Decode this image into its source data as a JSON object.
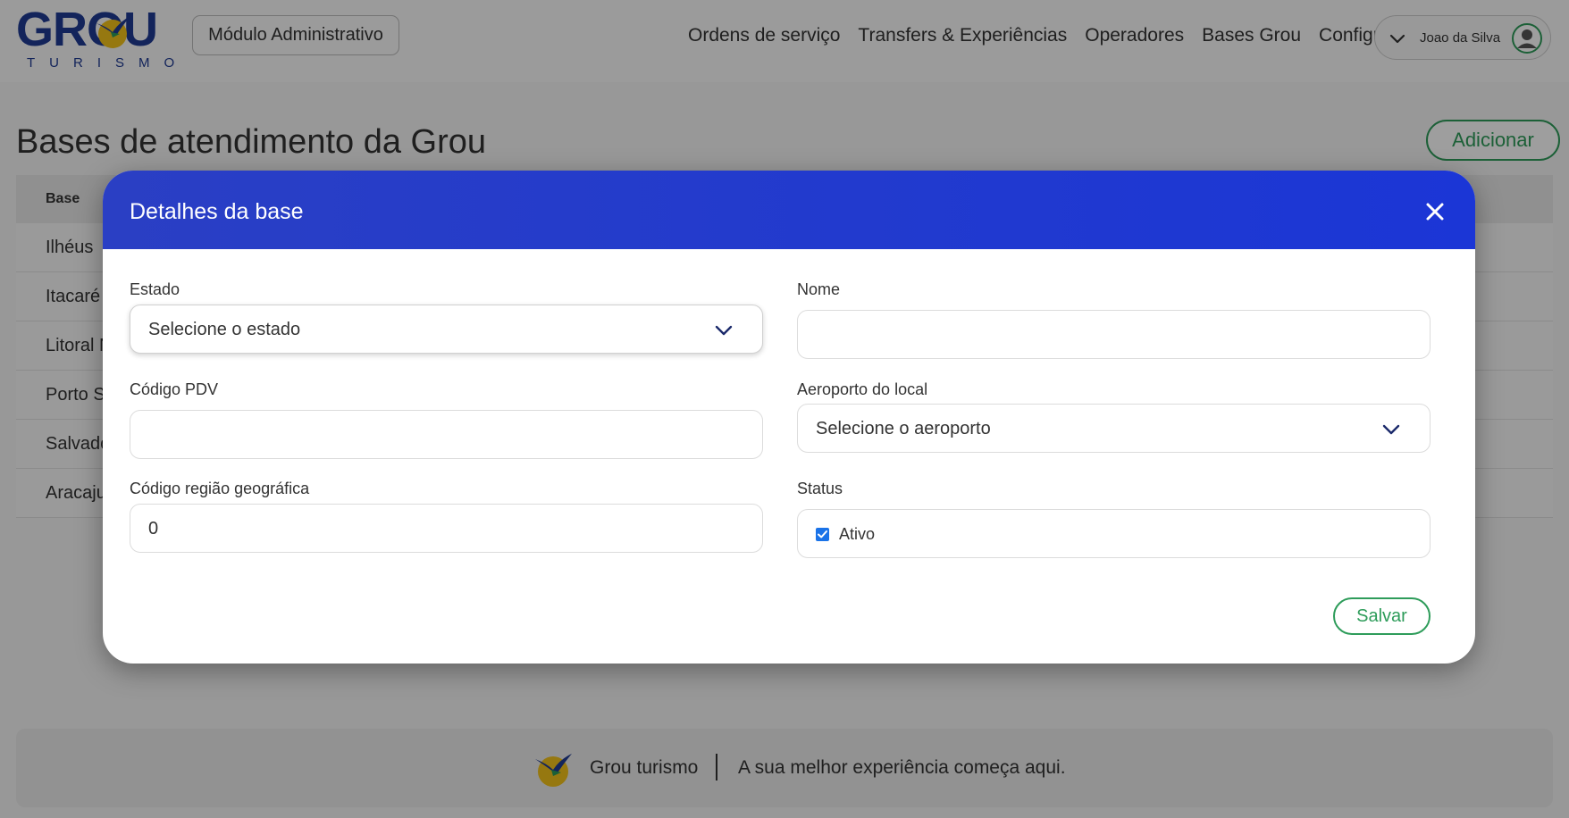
{
  "app": {
    "logo_text": "GROU",
    "logo_subtitle": "TURISMO",
    "module_label": "Módulo Administrativo"
  },
  "nav": {
    "items": [
      "Ordens de serviço",
      "Transfers & Experiências",
      "Operadores",
      "Bases Grou",
      "Configuração"
    ]
  },
  "user": {
    "name": "Joao da Silva"
  },
  "page": {
    "title": "Bases de atendimento da Grou",
    "add_label": "Adicionar",
    "table_header": "Base",
    "rows": [
      "Ilhéus",
      "Itacaré",
      "Litoral N",
      "Porto Se",
      "Salvado",
      "Aracaju"
    ]
  },
  "footer": {
    "name": "Grou turismo",
    "tagline": "A sua melhor experiência começa aqui."
  },
  "modal": {
    "title": "Detalhes da base",
    "estado": {
      "label": "Estado",
      "value": "Selecione o estado"
    },
    "nome": {
      "label": "Nome",
      "value": ""
    },
    "codigo_pdv": {
      "label": "Código PDV",
      "value": ""
    },
    "aeroporto": {
      "label": "Aeroporto do local",
      "value": "Selecione o aeroporto"
    },
    "codigo_regiao": {
      "label": "Código região geográfica",
      "value": "0"
    },
    "status": {
      "label": "Status",
      "checkbox_label": "Ativo",
      "checked": true
    },
    "save_label": "Salvar"
  },
  "colors": {
    "brand_blue": "#1f3a93",
    "modal_header": "#1b36d6",
    "accent_green": "#2e9c5a",
    "logo_yellow": "#f2c21b"
  }
}
